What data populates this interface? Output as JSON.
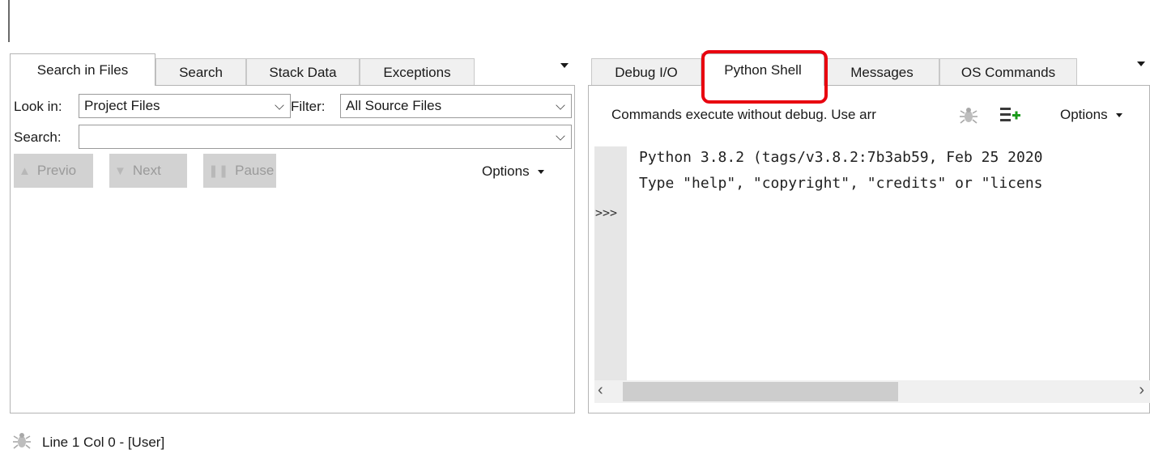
{
  "left_tabs": [
    {
      "label": "Search in Files",
      "active": true
    },
    {
      "label": "Search",
      "active": false
    },
    {
      "label": "Stack Data",
      "active": false
    },
    {
      "label": "Exceptions",
      "active": false
    }
  ],
  "right_tabs": [
    {
      "label": "Debug I/O",
      "active": false
    },
    {
      "label": "Python Shell",
      "active": true
    },
    {
      "label": "Messages",
      "active": false
    },
    {
      "label": "OS Commands",
      "active": false
    }
  ],
  "search": {
    "look_in_label": "Look in:",
    "look_in_value": "Project Files",
    "filter_label": "Filter:",
    "filter_value": "All Source Files",
    "search_label": "Search:",
    "search_value": "",
    "prev_label": "Previo",
    "next_label": "Next",
    "pause_label": "Pause",
    "options_label": "Options"
  },
  "shell": {
    "description": "Commands execute without debug.  Use arr",
    "options_label": "Options",
    "lines": [
      "Python 3.8.2 (tags/v3.8.2:7b3ab59, Feb 25 2020",
      "Type \"help\", \"copyright\", \"credits\" or \"licens"
    ],
    "prompt": ">>>"
  },
  "status": {
    "text": "Line 1 Col 0 - [User]"
  },
  "colors": {
    "highlight": "#e8000f",
    "disabled_button": "#d2d2d2",
    "add_green": "#1a9a1a"
  },
  "icons": {
    "debug": "bug-icon",
    "add": "add-list-icon",
    "previous": "arrow-up-icon",
    "next": "arrow-down-icon",
    "pause": "pause-icon"
  }
}
